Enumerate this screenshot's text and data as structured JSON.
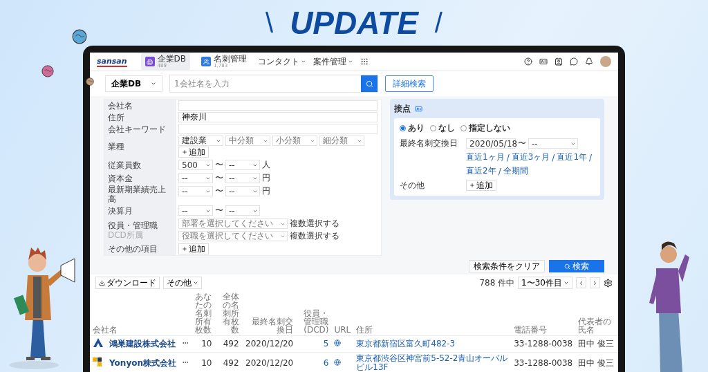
{
  "banner": {
    "title": "UPDATE",
    "left_mark": "\\",
    "right_mark": "/"
  },
  "nav": {
    "logo": "sansan",
    "items": [
      {
        "label": "企業DB",
        "count": "489",
        "selected": true
      },
      {
        "label": "名刺管理",
        "count": "1,783",
        "selected": false
      }
    ],
    "menus": [
      "コンタクト",
      "案件管理"
    ]
  },
  "search": {
    "scope": "企業DB",
    "placeholder": "1会社名を入力",
    "advanced": "詳細検索"
  },
  "conditions": [
    {
      "kind": "text",
      "label": "会社名"
    },
    {
      "kind": "text",
      "label": "住所",
      "value": "神奈川"
    },
    {
      "kind": "text",
      "label": "会社キーワード"
    },
    {
      "kind": "selects",
      "label": "業種",
      "selects": [
        {
          "text": "建設業",
          "filled": true
        },
        {
          "text": "中分類",
          "filled": false
        },
        {
          "text": "小分類",
          "filled": false
        },
        {
          "text": "細分類",
          "filled": false
        }
      ],
      "add": "追加"
    },
    {
      "kind": "range",
      "label": "従業員数",
      "from": "500",
      "sep": "〜",
      "to": "--",
      "unit": "人"
    },
    {
      "kind": "range",
      "label": "資本金",
      "from": "--",
      "sep": "〜",
      "to": "--",
      "unit": "円"
    },
    {
      "kind": "range",
      "label": "最新期業績売上高",
      "from": "--",
      "sep": "〜",
      "to": "--",
      "unit": "円"
    },
    {
      "kind": "range",
      "label": "決算月",
      "from": "--",
      "sep": "〜",
      "to": "--"
    },
    {
      "kind": "role",
      "label": "役員・管理職",
      "sublabel": "DCD所属",
      "lines": [
        {
          "select": "部署を選択してください",
          "option": "複数選択する"
        },
        {
          "select": "役職を選択してください",
          "option": "複数選択する"
        }
      ]
    },
    {
      "kind": "add",
      "label": "その他の項目",
      "add": "追加"
    }
  ],
  "contact": {
    "title": "接点",
    "radios": [
      {
        "label": "あり",
        "selected": true
      },
      {
        "label": "なし",
        "selected": false
      },
      {
        "label": "指定しない",
        "selected": false
      }
    ],
    "date_label": "最終名刺交換日",
    "date_from": "2020/05/18",
    "date_sep": "〜",
    "date_to": "--",
    "shortcuts": [
      "直近1ヶ月",
      "直近3ヶ月",
      "直近1年",
      "直近2年",
      "全期間"
    ],
    "shortcut_separator": "/",
    "other_label": "その他",
    "add": "追加"
  },
  "actions": {
    "clear": "検索条件をクリア",
    "search": "検索"
  },
  "toolbar": {
    "download": "ダウンロード",
    "more": "その他",
    "total": "788 件中",
    "range": "1〜30件目"
  },
  "table": {
    "columns": [
      "会社名",
      "",
      "あなたの名刺所有枚数",
      "全体の名刺所有枚数",
      "最終名刺交換日",
      "役員・管理職(DCD)",
      "URL",
      "住所",
      "電話番号",
      "代表者の氏名"
    ],
    "rows": [
      {
        "kind": "triangle",
        "name": "鴻巣建設株式会社",
        "cards_mine": "10",
        "cards_all": "492",
        "last_exchange": "2020/12/20",
        "executives": "5",
        "address": "東京都新宿区富久町482-3",
        "phone": "33-1288-0038",
        "representative": "田中 俊三"
      },
      {
        "kind": "squares",
        "name": "Yonyon株式会社",
        "cards_mine": "10",
        "cards_all": "492",
        "last_exchange": "2020/12/20",
        "executives": "6",
        "address": "東京都渋谷区神宮前5-52-2青山オーバルビル13F",
        "phone": "33-1288-0038",
        "representative": "田中 俊三"
      }
    ]
  }
}
